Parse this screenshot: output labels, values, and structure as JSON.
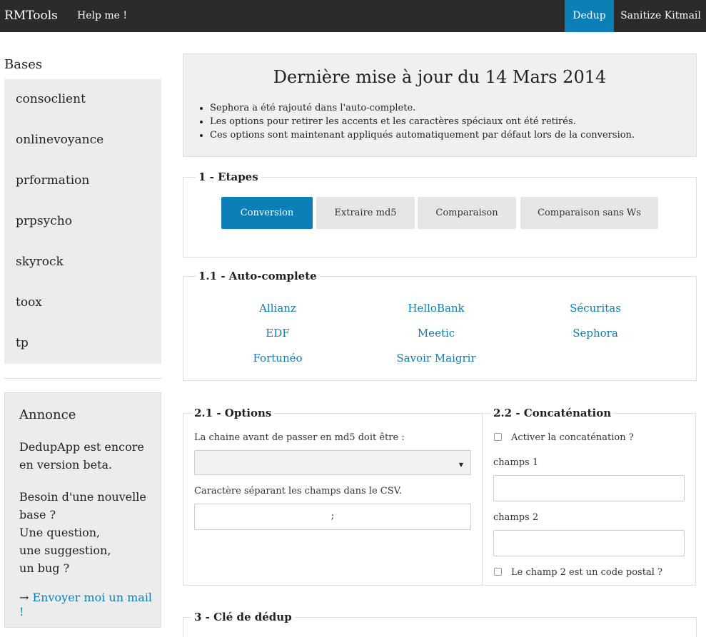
{
  "topbar": {
    "brand": "RMTools",
    "help": "Help me !",
    "nav": [
      "Dedup",
      "Sanitize Kitmail"
    ]
  },
  "sidebar": {
    "title": "Bases",
    "items": [
      "consoclient",
      "onlinevoyance",
      "prformation",
      "prpsycho",
      "skyrock",
      "toox",
      "tp"
    ]
  },
  "annonce": {
    "title": "Annonce",
    "text1": "DedupApp est encore\nen version beta.",
    "text2": "Besoin d'une nouvelle\nbase ?\nUne question,\nune suggestion,\nun bug ?",
    "arrow": "→",
    "link": "Envoyer moi un mail !"
  },
  "update": {
    "title": "Dernière mise à jour du 14 Mars 2014",
    "items": [
      "Sephora a été rajouté dans l'auto-complete.",
      "Les options pour retirer les accents et les caractères spéciaux ont été retirés.",
      "Ces options sont maintenant appliqués automatiquement par défaut lors de la conversion."
    ]
  },
  "etapes": {
    "legend": "1 - Etapes",
    "buttons": [
      "Conversion",
      "Extraire md5",
      "Comparaison",
      "Comparaison sans Ws"
    ]
  },
  "autocomplete": {
    "legend": "1.1 - Auto-complete",
    "links": [
      "Allianz",
      "HelloBank",
      "Sécuritas",
      "EDF",
      "Meetic",
      "Sephora",
      "Fortunéo",
      "Savoir Maigrir"
    ]
  },
  "options": {
    "legend": "2.1 - Options",
    "label1": "La chaine avant de passer en md5 doit être :",
    "select_value": "",
    "label2": "Caractère séparant les champs dans le CSV.",
    "separator_value": ";"
  },
  "concat": {
    "legend": "2.2 - Concaténation",
    "checkbox1": "Activer la concaténation ?",
    "champs1_label": "champs 1",
    "champs2_label": "champs 2",
    "checkbox2": "Le champ 2 est un code postal ?"
  },
  "cle": {
    "legend": "3 - Clé de dédup"
  },
  "colors": {
    "accent": "#0d7fb7",
    "topbar": "#2b2b2b",
    "panel": "#ececec"
  }
}
